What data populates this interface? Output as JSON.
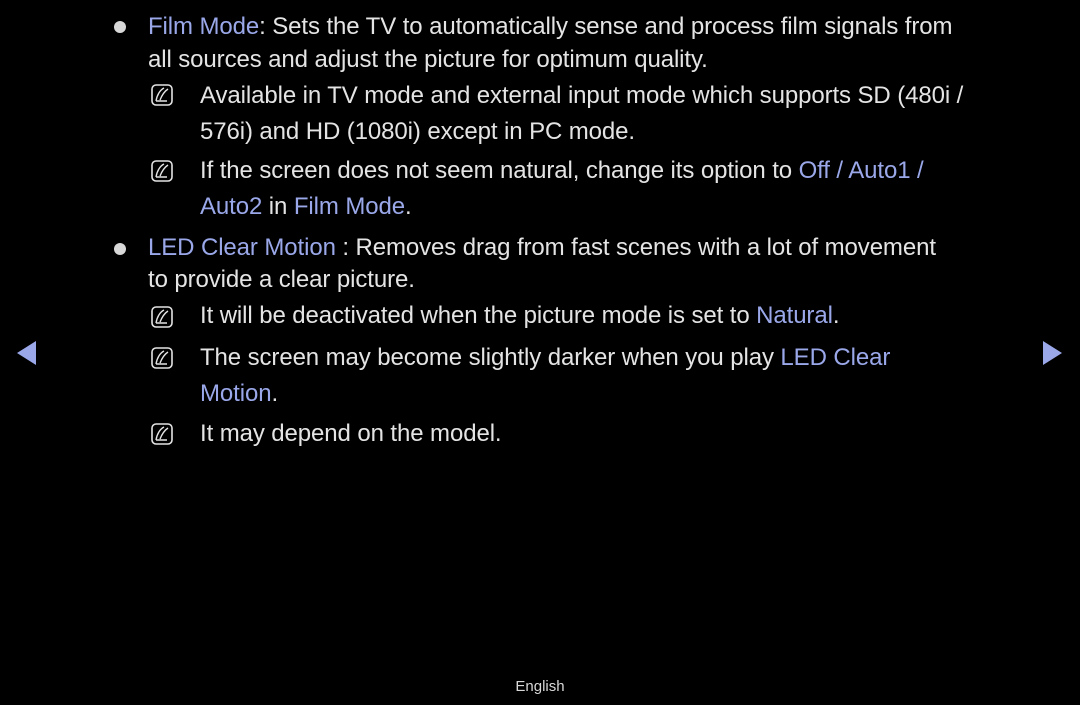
{
  "items": [
    {
      "term": "Film Mode",
      "separator": ":",
      "line1_rest": " Sets the TV to automatically sense and process film signals from",
      "line2": "all sources and adjust the picture for optimum quality.",
      "notes": [
        {
          "line1": "Available in TV mode and external input mode which supports SD (480i /",
          "line2": "576i) and HD (1080i) except in PC mode."
        },
        {
          "line1_text": "If the screen does not seem natural, change its option to ",
          "line1_hl": "Off / Auto1 /",
          "line2_hl1": "Auto2",
          "line2_mid": " in ",
          "line2_hl2": "Film Mode",
          "line2_end": "."
        }
      ]
    },
    {
      "term": "LED Clear Motion",
      "line1_rest": " : Removes drag from fast scenes with a lot of movement",
      "line2": "to provide a clear picture.",
      "notes": [
        {
          "text": "It will be deactivated when the picture mode is set to ",
          "hl": "Natural",
          "end": "."
        },
        {
          "line1_text": "The screen may become slightly darker when you play ",
          "line1_hl": "LED Clear",
          "line2_hl": "Motion",
          "line2_end": "."
        },
        {
          "text": "It may depend on the model."
        }
      ]
    }
  ],
  "navigation": {
    "prev_icon": "triangle-left-icon",
    "next_icon": "triangle-right-icon"
  },
  "footer": {
    "language": "English"
  },
  "colors": {
    "highlight": "#9aa8ea",
    "text": "#e4e4e4",
    "background": "#000000"
  }
}
